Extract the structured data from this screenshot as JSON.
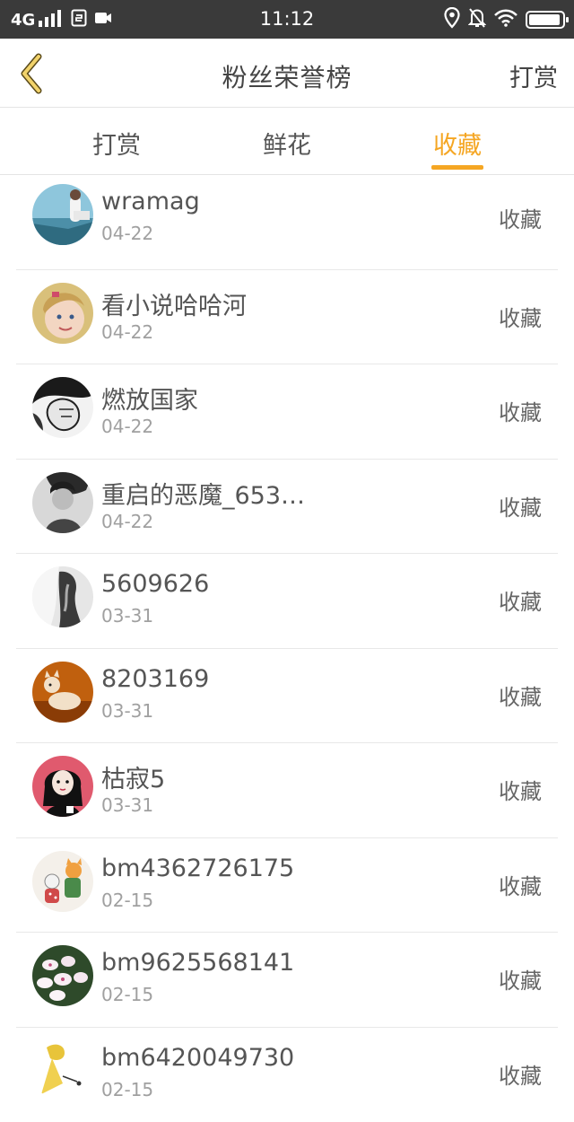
{
  "status_bar": {
    "network": "4G",
    "time": "11:12",
    "battery_level": 0.95
  },
  "header": {
    "title": "粉丝荣誉榜",
    "action_label": "打赏"
  },
  "tabs": [
    {
      "label": "打赏",
      "active": false
    },
    {
      "label": "鲜花",
      "active": false
    },
    {
      "label": "收藏",
      "active": true
    }
  ],
  "accent_color": "#f5a623",
  "fans": [
    {
      "name": "wramag",
      "date": "04-22",
      "type": "收藏"
    },
    {
      "name": "看小说哈哈河",
      "date": "04-22",
      "type": "收藏"
    },
    {
      "name": "燃放国家",
      "date": "04-22",
      "type": "收藏"
    },
    {
      "name": "重启的恶魔_653…",
      "date": "04-22",
      "type": "收藏"
    },
    {
      "name": "5609626",
      "date": "03-31",
      "type": "收藏"
    },
    {
      "name": "8203169",
      "date": "03-31",
      "type": "收藏"
    },
    {
      "name": "枯寂5",
      "date": "03-31",
      "type": "收藏"
    },
    {
      "name": "bm4362726175",
      "date": "02-15",
      "type": "收藏"
    },
    {
      "name": "bm9625568141",
      "date": "02-15",
      "type": "收藏"
    },
    {
      "name": "bm6420049730",
      "date": "02-15",
      "type": "收藏"
    }
  ]
}
